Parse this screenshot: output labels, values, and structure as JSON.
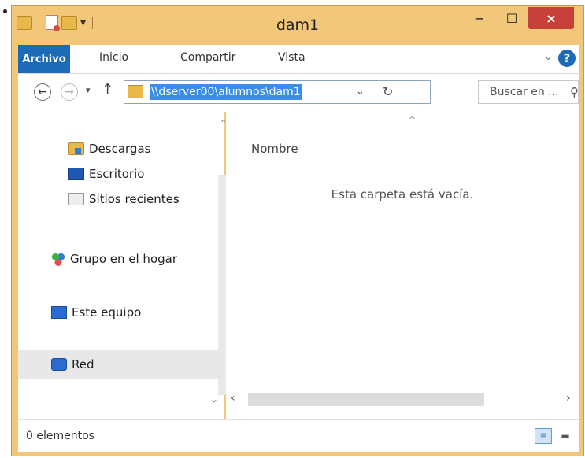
{
  "window": {
    "title": "dam1",
    "controls": {
      "minimize": "−",
      "maximize": "☐",
      "close": "×"
    },
    "qat_arrow": "▾"
  },
  "ribbon": {
    "tabs": [
      {
        "label": "Archivo"
      },
      {
        "label": "Inicio"
      },
      {
        "label": "Compartir"
      },
      {
        "label": "Vista"
      }
    ],
    "chevron": "⌄",
    "help": "?"
  },
  "address": {
    "back": "←",
    "forward": "→",
    "recent": "▾",
    "up": "↑",
    "path": "\\\\dserver00\\alumnos\\dam1",
    "dropdown": "⌄",
    "refresh": "↻"
  },
  "search": {
    "placeholder": "Buscar en ...",
    "icon": "⚲"
  },
  "nav": {
    "items": [
      {
        "label": "Descargas",
        "icon": "downloads-icon"
      },
      {
        "label": "Escritorio",
        "icon": "desktop-icon"
      },
      {
        "label": "Sitios recientes",
        "icon": "recent-places-icon"
      },
      {
        "label": "Grupo en el hogar",
        "icon": "homegroup-icon"
      },
      {
        "label": "Este equipo",
        "icon": "this-pc-icon"
      },
      {
        "label": "Red",
        "icon": "network-icon"
      }
    ],
    "scroll_up": "⌃",
    "scroll_down": "⌄"
  },
  "content": {
    "column_header": "Nombre",
    "sort_indicator": "^",
    "empty_message": "Esta carpeta está vacía.",
    "hscroll_left": "‹",
    "hscroll_right": "›"
  },
  "status": {
    "count": "0 elementos",
    "details_view": "≣",
    "tiles_view": "▬"
  }
}
